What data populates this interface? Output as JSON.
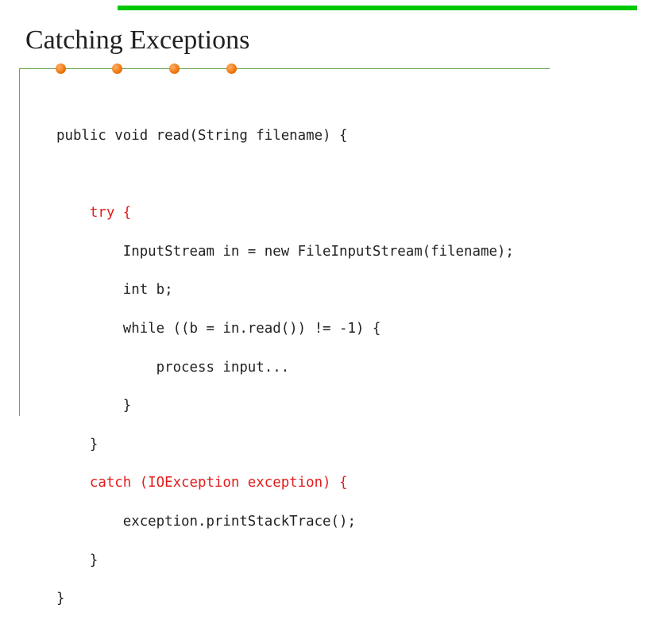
{
  "slide": {
    "title": "Catching Exceptions",
    "accent_color": "#00c800",
    "rule_color": "#6aa84f",
    "bullet_color": "#f07a12",
    "keyword_color": "#e31b1b",
    "bullet_dots_count": 4
  },
  "code": {
    "language": "Java",
    "lines": [
      "public void read(String filename) {",
      "",
      "    try {",
      "        InputStream in = new FileInputStream(filename);",
      "        int b;",
      "        while ((b = in.read()) != -1) {",
      "            process input...",
      "        }",
      "    }",
      "    catch (IOException exception) {",
      "        exception.printStackTrace();",
      "    }",
      "}"
    ],
    "highlighted_line_indices": [
      2,
      9
    ]
  }
}
